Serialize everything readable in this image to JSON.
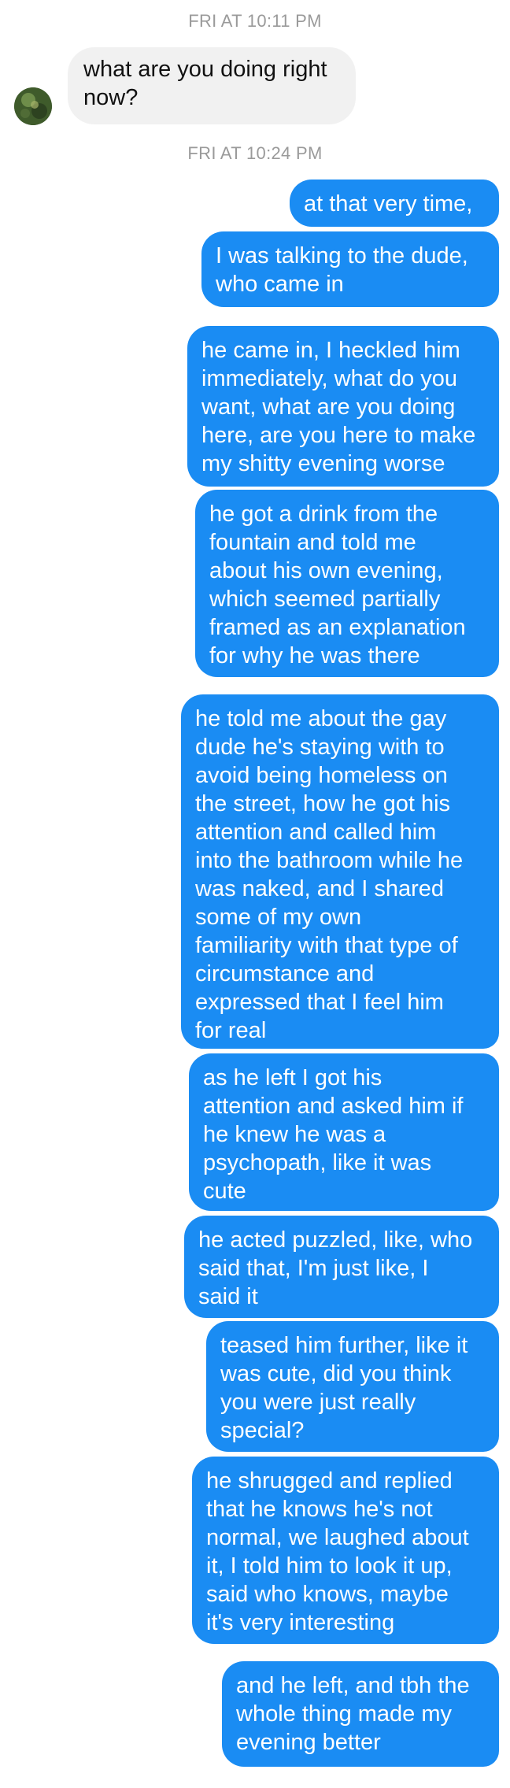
{
  "colors": {
    "outgoing_bubble": "#1a8cf3",
    "incoming_bubble": "#f1f1f1",
    "timestamp_text": "#9a9a9a"
  },
  "thread": {
    "timestamps": [
      "FRI AT 10:11 PM",
      "FRI AT 10:24 PM"
    ],
    "incoming": [
      {
        "avatar_icon": "contact-avatar-photo",
        "text": "what are you doing right\nnow?"
      }
    ],
    "outgoing": [
      {
        "text": "at that very time,"
      },
      {
        "text": "I was talking to the dude,\nwho came in"
      },
      {
        "text": "he came in, I heckled him\nimmediately, what do you\nwant, what are you doing\nhere, are you here to make\nmy shitty evening worse"
      },
      {
        "text": "he got a drink from the\nfountain and told me\nabout his own evening,\nwhich seemed partially\nframed as an explanation\nfor why he was there"
      },
      {
        "text": "he told me about the gay\ndude he's staying with to\navoid being homeless on\nthe street, how he got his\nattention and called him\ninto the bathroom while he\nwas naked, and I shared\nsome of my own\nfamiliarity with that type of\ncircumstance and\nexpressed that I feel him\nfor real"
      },
      {
        "text": "as he left I got his\nattention and asked him if\nhe knew he was a\npsychopath, like it was\ncute"
      },
      {
        "text": "he acted puzzled, like, who\nsaid that, I'm just like, I\nsaid it"
      },
      {
        "text": "teased him further, like it\nwas cute, did you think\nyou were just really\nspecial?"
      },
      {
        "text": "he shrugged and replied\nthat he knows he's not\nnormal, we laughed about\nit, I told him to look it up,\nsaid who knows, maybe\nit's very interesting"
      },
      {
        "text": "and he left, and tbh the\nwhole thing made my\nevening better"
      }
    ]
  }
}
